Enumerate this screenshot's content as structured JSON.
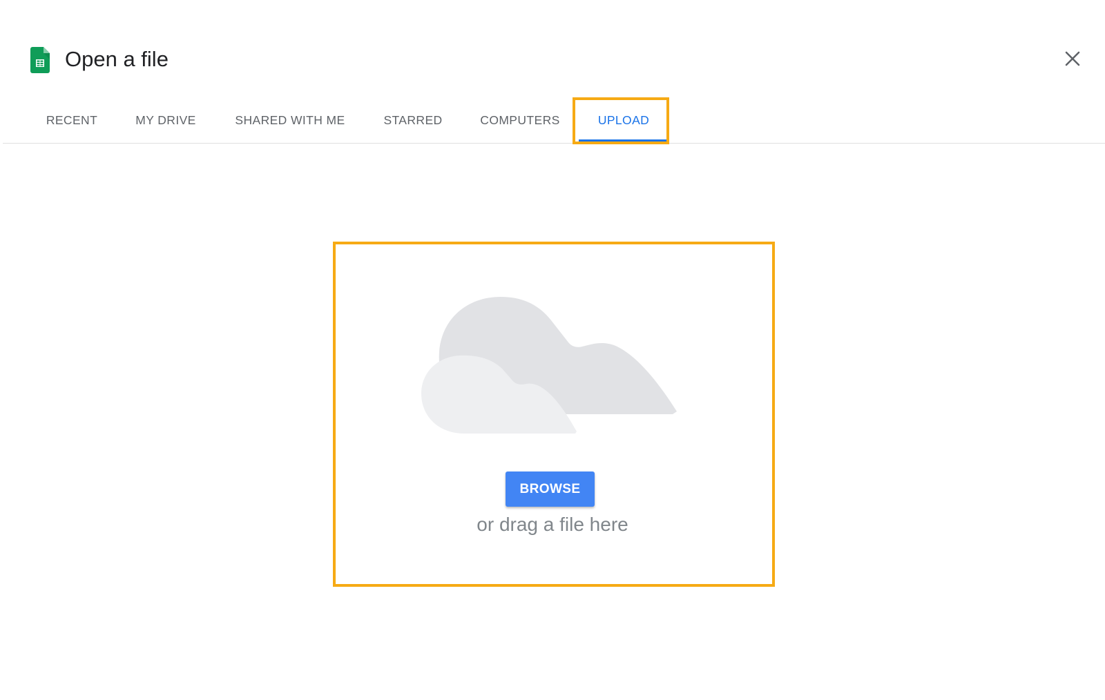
{
  "dialog": {
    "title": "Open a file",
    "app_icon": "google-sheets-icon",
    "close_icon": "close-icon"
  },
  "tabs": [
    {
      "label": "RECENT",
      "active": false
    },
    {
      "label": "MY DRIVE",
      "active": false
    },
    {
      "label": "SHARED WITH ME",
      "active": false
    },
    {
      "label": "STARRED",
      "active": false
    },
    {
      "label": "COMPUTERS",
      "active": false
    },
    {
      "label": "UPLOAD",
      "active": true
    }
  ],
  "upload": {
    "illustration": "cloud-illustration",
    "browse_label": "BROWSE",
    "drag_text": "or drag a file here"
  },
  "colors": {
    "accent": "#1a73e8",
    "button": "#4285f4",
    "highlight": "#f6aa14",
    "sheets_green": "#0f9d58"
  }
}
